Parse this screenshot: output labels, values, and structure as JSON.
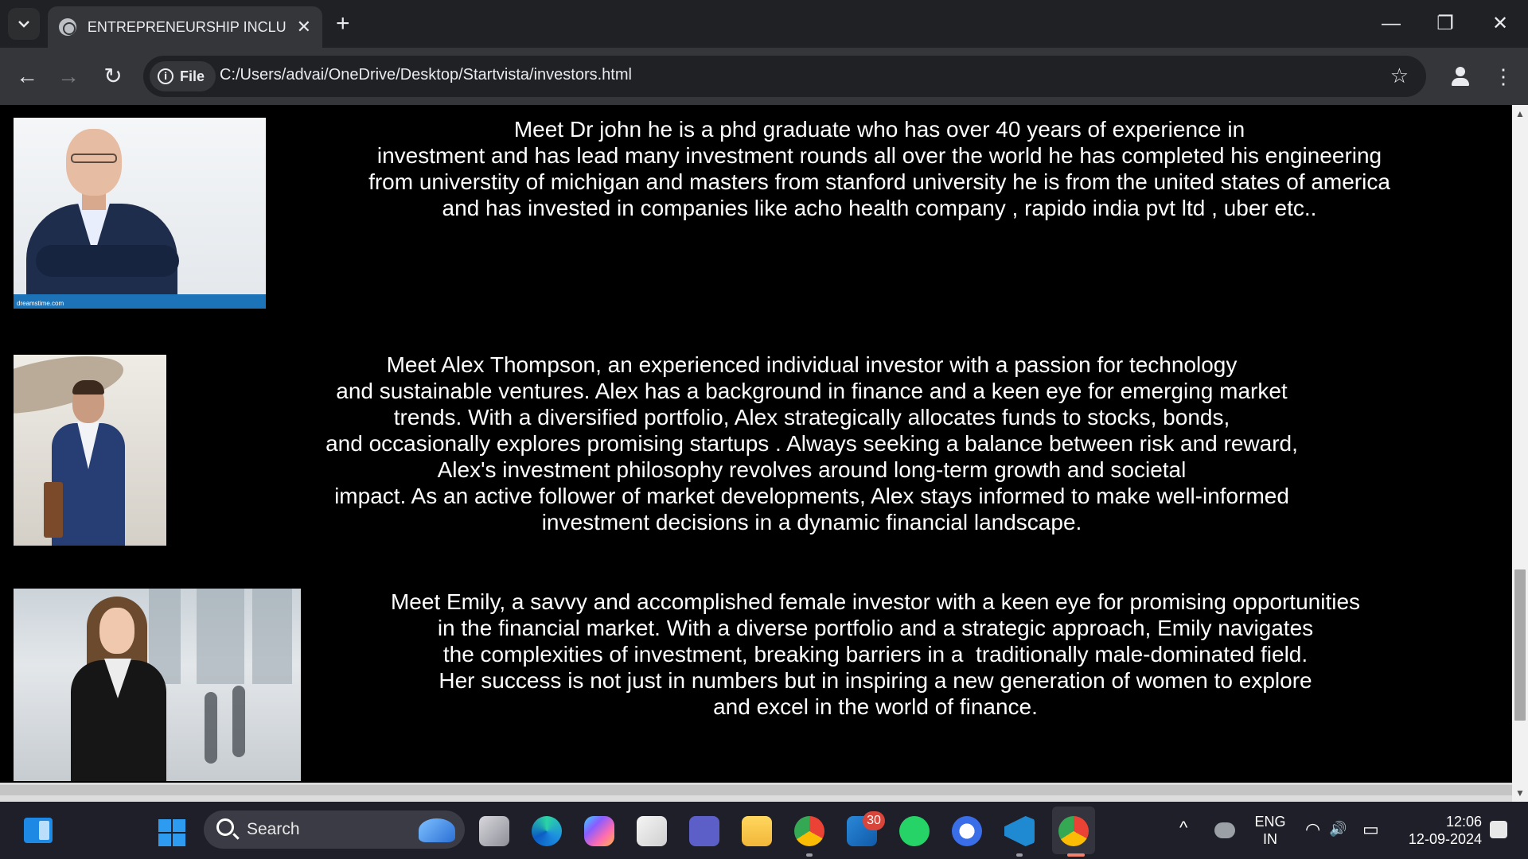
{
  "browser": {
    "tab": {
      "title": "ENTREPRENEURSHIP INCLUBLA",
      "close_glyph": "✕"
    },
    "new_tab_glyph": "+",
    "window_controls": {
      "minimize": "—",
      "restore": "❐",
      "close": "✕"
    },
    "nav": {
      "back": "←",
      "forward": "→",
      "reload": "↻"
    },
    "site_chip": {
      "info_glyph": "i",
      "label": "File"
    },
    "url": "C:/Users/advai/OneDrive/Desktop/Startvista/investors.html",
    "bookmark_glyph": "☆",
    "menu_glyph": "⋮"
  },
  "page": {
    "investors": [
      {
        "bio": "Meet Dr john he is a phd graduate who has over 40 years of experience in\ninvestment and has lead many investment rounds all over the world he has completed his engineering\nfrom universtity of michigan and masters from stanford university he is from the united states of america\nand has invested in companies like acho health company , rapido india pvt ltd , uber etc..",
        "photo_caption": "dreamstime.com"
      },
      {
        "bio": "Meet Alex Thompson, an experienced individual investor with a passion for technology\nand sustainable ventures. Alex has a background in finance and a keen eye for emerging market\ntrends. With a diversified portfolio, Alex strategically allocates funds to stocks, bonds,\nand occasionally explores promising startups . Always seeking a balance between risk and reward,\nAlex's investment philosophy revolves around long-term growth and societal\nimpact. As an active follower of market developments, Alex stays informed to make well-informed\ninvestment decisions in a dynamic financial landscape."
      },
      {
        "bio": "Meet Emily, a savvy and accomplished female investor with a keen eye for promising opportunities\nin the financial market. With a diverse portfolio and a strategic approach, Emily navigates\nthe complexities of investment, breaking barriers in a  traditionally male-dominated field.\nHer success is not just in numbers but in inspiring a new generation of women to explore\nand excel in the world of finance."
      }
    ]
  },
  "scrollbar": {
    "up_glyph": "▲",
    "down_glyph": "▼"
  },
  "taskbar": {
    "search_label": "Search",
    "badge_count": "30",
    "tray": {
      "chevron": "^",
      "lang_line1": "ENG",
      "lang_line2": "IN",
      "wifi": "◠",
      "volume": "🔊",
      "battery": "▭",
      "time": "12:06",
      "date": "12-09-2024"
    }
  },
  "colors": {
    "page_bg": "#000000",
    "text": "#ffffff",
    "chrome_dark": "#202124",
    "chrome_toolbar": "#35363a",
    "taskbar": "#1f1f2a"
  }
}
